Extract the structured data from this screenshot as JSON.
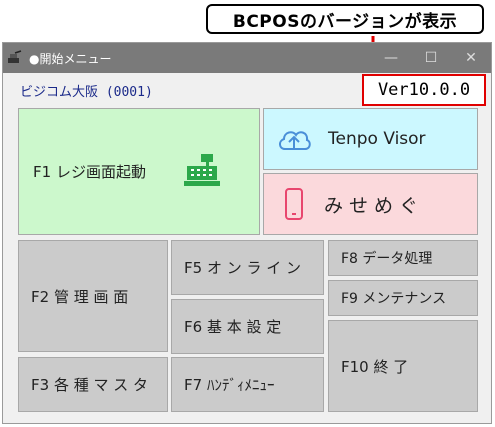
{
  "callout": {
    "text": "BCPOSのバージョンが表示"
  },
  "window": {
    "title": "●開始メニュー",
    "controls": {
      "minimize": "—",
      "maximize": "☐",
      "close": "✕"
    }
  },
  "company": "ビジコム大阪 (0001)",
  "version": "Ver10.0.0",
  "buttons": {
    "f1": "F1 レジ画面起動",
    "tenpo": "Tenpo Visor",
    "mise": "みせめぐ",
    "f2": "F2 管 理 画 面",
    "f3": "F3 各 種 マ ス タ",
    "f5": "F5 オ ン ラ イ ン",
    "f6": "F6 基 本 設 定",
    "f7": "F7 ﾊﾝﾃﾞｨﾒﾆｭｰ",
    "f8": "F8 データ処理",
    "f9": "F9 メンテナンス",
    "f10": "F10 終 了"
  },
  "colors": {
    "f1_bg": "#ccf8cc",
    "tenpo_bg": "#ccf8ff",
    "mise_bg": "#fbd9dc",
    "register_icon": "#2ca84a",
    "cloud_icon": "#4a8fd8",
    "phone_icon": "#e8466e",
    "highlight": "#e00000"
  },
  "icons": [
    "cash-register-icon",
    "cloud-upload-icon",
    "smartphone-icon"
  ]
}
